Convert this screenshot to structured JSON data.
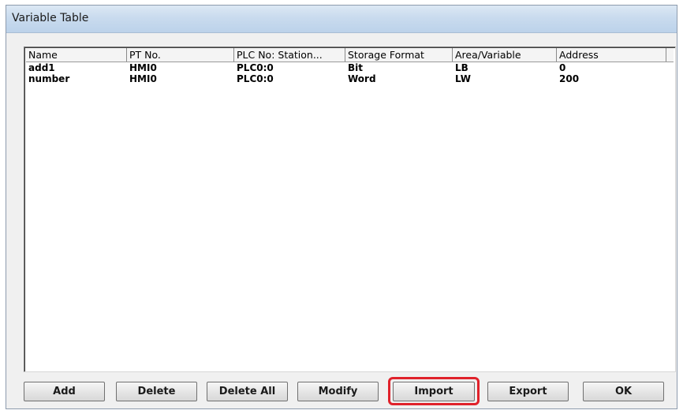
{
  "window": {
    "title": "Variable Table"
  },
  "table": {
    "columns": [
      "Name",
      "PT No.",
      "PLC No: Station...",
      "Storage Format",
      "Area/Variable",
      "Address"
    ],
    "rows": [
      [
        "add1",
        "HMI0",
        "PLC0:0",
        "Bit",
        "LB",
        "0"
      ],
      [
        "number",
        "HMI0",
        "PLC0:0",
        "Word",
        "LW",
        "200"
      ]
    ]
  },
  "buttons": {
    "add": "Add",
    "delete": "Delete",
    "delete_all": "Delete All",
    "modify": "Modify",
    "import": "Import",
    "export": "Export",
    "ok": "OK"
  },
  "colors": {
    "highlight": "#e0222b",
    "titlebar": "#c9dbee"
  }
}
